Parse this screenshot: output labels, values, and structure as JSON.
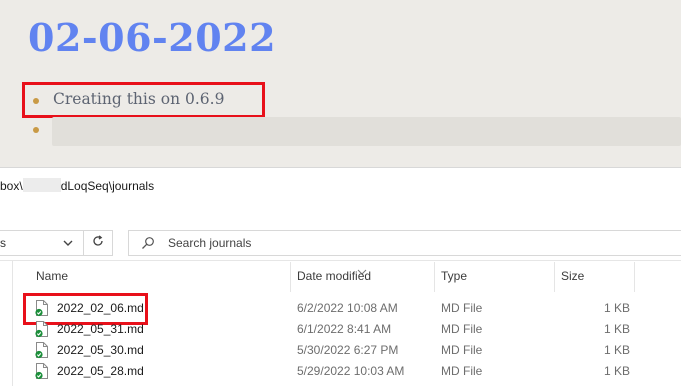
{
  "journal": {
    "title": "02-06-2022",
    "blocks": [
      {
        "text": "Creating this on 0.6.9"
      },
      {
        "text": ""
      }
    ]
  },
  "explorer": {
    "path_prefix": "box\\",
    "path_suffix": "dLoqSeq\\journals",
    "address_fragment": "s",
    "search_placeholder": "Search journals",
    "columns": {
      "name": "Name",
      "date_modified": "Date modified",
      "type": "Type",
      "size": "Size"
    },
    "files": [
      {
        "name": "2022_02_06.md",
        "date": "6/2/2022 10:08 AM",
        "type": "MD File",
        "size": "1 KB"
      },
      {
        "name": "2022_05_31.md",
        "date": "6/1/2022 8:41 AM",
        "type": "MD File",
        "size": "1 KB"
      },
      {
        "name": "2022_05_30.md",
        "date": "5/30/2022 6:27 PM",
        "type": "MD File",
        "size": "1 KB"
      },
      {
        "name": "2022_05_28.md",
        "date": "5/29/2022 10:03 AM",
        "type": "MD File",
        "size": "1 KB"
      }
    ]
  },
  "colors": {
    "journal_title": "#6183f0",
    "bullet": "#c99a45",
    "highlight": "#e8101a",
    "sync_badge": "#1b8f3a"
  },
  "icons": [
    "chevron-down-icon",
    "refresh-icon",
    "search-icon",
    "md-file-icon",
    "sync-check-icon",
    "sort-caret-icon"
  ]
}
